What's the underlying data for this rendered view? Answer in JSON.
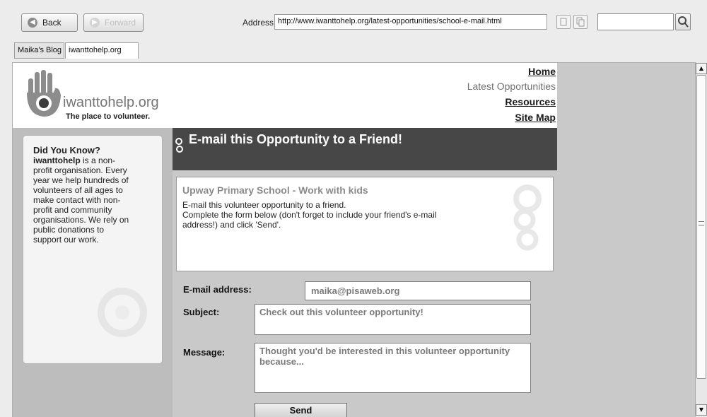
{
  "toolbar": {
    "back_label": "Back",
    "forward_label": "Forward",
    "address_label": "Address",
    "address_value": "http://www.iwanttohelp.org/latest-opportunities/school-e-mail.html",
    "search_value": ""
  },
  "tabs": [
    {
      "label": "Maika's Blog"
    },
    {
      "label": "iwanttohelp.org"
    }
  ],
  "site": {
    "logo_text": "iwanttohelp.org",
    "tagline": "The place to volunteer."
  },
  "nav": {
    "home": "Home",
    "latest": "Latest Opportunities",
    "resources": "Resources",
    "sitemap": "Site Map"
  },
  "sidebar": {
    "title": "Did You Know?",
    "brand": "iwanttohelp",
    "lines": [
      " is a non-",
      "profit organisation. Every",
      "year we help hundreds of",
      "volunteers of all ages to",
      "make contact with non-",
      "profit and community",
      "organisations. We rely on",
      "public donations to",
      "support our work."
    ]
  },
  "main": {
    "title": "E-mail this Opportunity to a Friend!",
    "opportunity_title": "Upway Primary School - Work with kids",
    "intro_lines": [
      "E-mail this volunteer opportunity to a friend.",
      "Complete the form below (don't forget to include your friend's e-mail",
      "address!) and click 'Send'."
    ]
  },
  "form": {
    "email_label": "E-mail address:",
    "email_value": "maika@pisaweb.org",
    "subject_label": "Subject:",
    "subject_value": "Check out this volunteer opportunity!",
    "message_label": "Message:",
    "message_value": "Thought you'd be interested in this volunteer opportunity because...",
    "send_label": "Send"
  },
  "colors": {
    "title_bar": "#474747",
    "logo_text": "#767676",
    "sidebar_bg": "#bdbdbd"
  }
}
